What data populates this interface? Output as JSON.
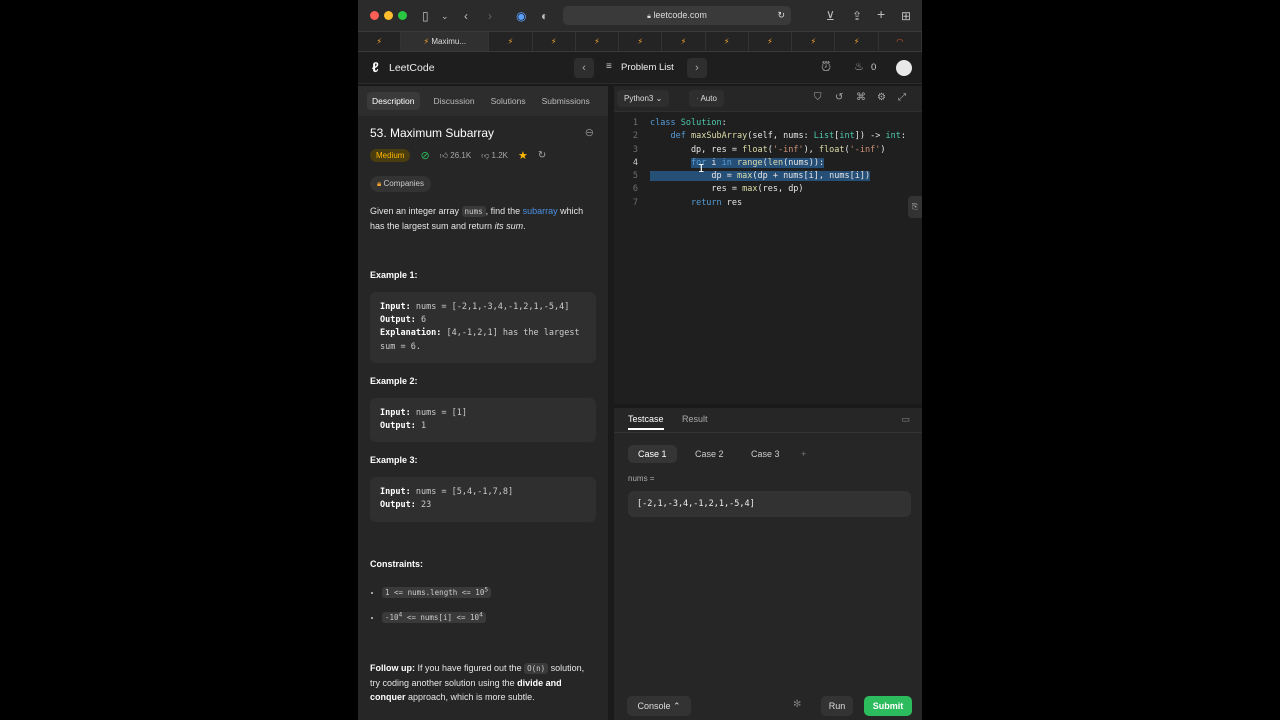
{
  "browser": {
    "url": "leetcode.com",
    "active_tab": "Maximu...",
    "colors": {
      "close": "#ff5f57",
      "minimize": "#febc2e",
      "zoom": "#28c840"
    }
  },
  "nav": {
    "logo_text": "LeetCode",
    "problem_list": "Problem List",
    "streak_count": "0"
  },
  "left_tabs": [
    "Description",
    "Discussion",
    "Solutions",
    "Submissions"
  ],
  "problem": {
    "title": "53. Maximum Subarray",
    "difficulty": "Medium",
    "likes": "26.1K",
    "dislikes": "1.2K",
    "companies": "Companies",
    "desc_a": "Given an integer array ",
    "desc_code": "nums",
    "desc_b": ", find the ",
    "desc_link": "subarray",
    "desc_c": " which has the largest sum and return ",
    "desc_em": "its sum",
    "desc_d": ".",
    "examples": [
      {
        "title": "Example 1:",
        "input_label": "Input:",
        "input": "nums = [-2,1,-3,4,-1,2,1,-5,4]",
        "output_label": "Output:",
        "output": "6",
        "expl_label": "Explanation:",
        "expl": "[4,-1,2,1] has the largest sum = 6."
      },
      {
        "title": "Example 2:",
        "input_label": "Input:",
        "input": "nums = [1]",
        "output_label": "Output:",
        "output": "1"
      },
      {
        "title": "Example 3:",
        "input_label": "Input:",
        "input": "nums = [5,4,-1,7,8]",
        "output_label": "Output:",
        "output": "23"
      }
    ],
    "constraints_title": "Constraints:",
    "constraint_1": "1 <= nums.length <= 10",
    "constraint_1_sup": "5",
    "constraint_2a": "-10",
    "constraint_2a_sup": "4",
    "constraint_2b": " <= nums[i] <= 10",
    "constraint_2b_sup": "4",
    "followup_label": "Follow up:",
    "followup_a": " If you have figured out the ",
    "followup_code": "O(n)",
    "followup_b": " solution, try coding another solution using the ",
    "followup_bold": "divide and conquer",
    "followup_c": " approach, which is more subtle."
  },
  "editor": {
    "language": "Python3",
    "mode": "Auto"
  },
  "testcase": {
    "tabs": [
      "Testcase",
      "Result"
    ],
    "cases": [
      "Case 1",
      "Case 2",
      "Case 3"
    ],
    "add": "+",
    "param_label": "nums =",
    "param_value": "[-2,1,-3,4,-1,2,1,-5,4]",
    "console": "Console",
    "run": "Run",
    "submit": "Submit"
  }
}
